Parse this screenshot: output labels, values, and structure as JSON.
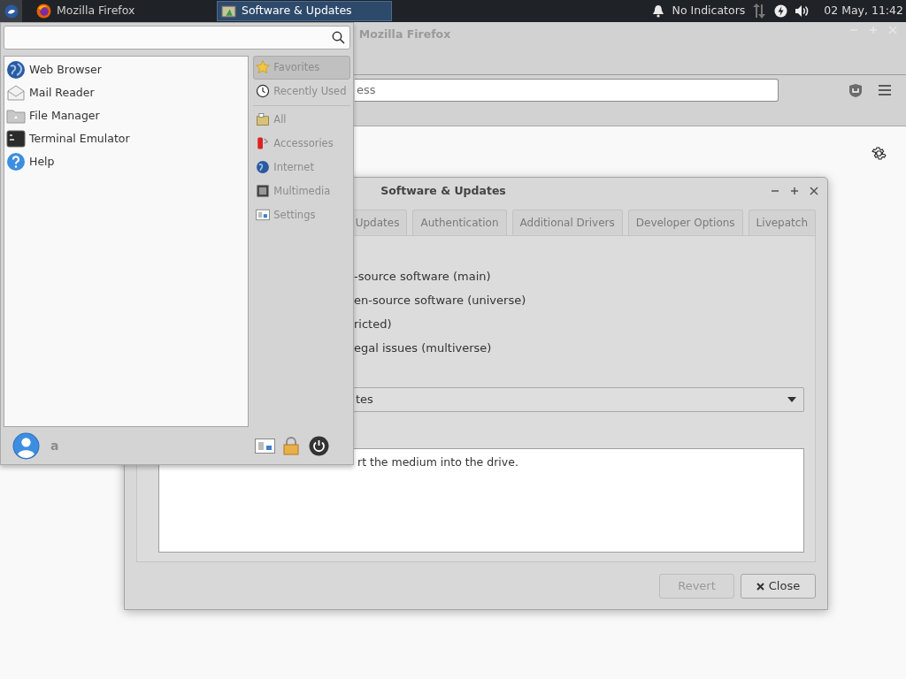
{
  "panel": {
    "tasks": [
      {
        "label": "Mozilla Firefox",
        "selected": false
      },
      {
        "label": "Software & Updates",
        "selected": true
      }
    ],
    "indicators": "No Indicators",
    "clock": "02 May, 11:42"
  },
  "firefox": {
    "title": "Mozilla Firefox",
    "address_placeholder": "ess"
  },
  "dialog": {
    "title": "Software & Updates",
    "tabs": [
      {
        "label": "Updates",
        "selected": false
      },
      {
        "label": "Authentication",
        "selected": false
      },
      {
        "label": "Additional Drivers",
        "selected": false
      },
      {
        "label": "Developer Options",
        "selected": false
      },
      {
        "label": "Livepatch",
        "selected": false
      }
    ],
    "options": [
      "-source software (main)",
      "en-source software (universe)",
      "ricted)",
      "egal issues (multiverse)"
    ],
    "dropdown_value": "tes",
    "notes": "rt the medium into the drive.",
    "buttons": [
      {
        "label": "Revert",
        "disabled": true,
        "kind": "plain"
      },
      {
        "label": "Close",
        "disabled": false,
        "kind": "close"
      }
    ]
  },
  "menu": {
    "apps": [
      "Web Browser",
      "Mail Reader",
      "File Manager",
      "Terminal Emulator",
      "Help"
    ],
    "category_groups": [
      [
        {
          "label": "Favorites",
          "selected": true
        },
        {
          "label": "Recently Used",
          "selected": false
        }
      ],
      [
        {
          "label": "All",
          "selected": false
        },
        {
          "label": "Accessories",
          "selected": false
        },
        {
          "label": "Internet",
          "selected": false
        },
        {
          "label": "Multimedia",
          "selected": false
        },
        {
          "label": "Settings",
          "selected": false
        }
      ]
    ],
    "user": "a"
  }
}
